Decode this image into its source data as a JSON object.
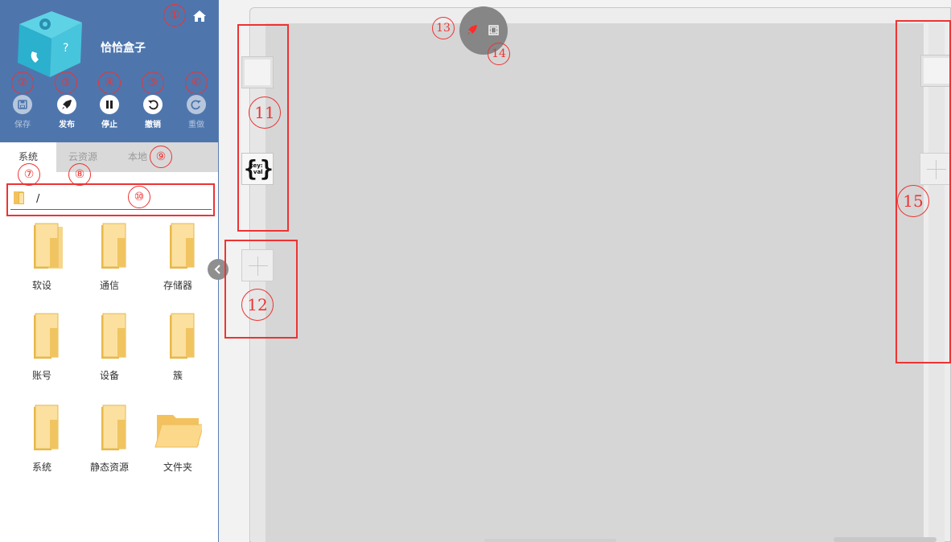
{
  "sidebar": {
    "app_title": "恰恰盒子",
    "toolbar": [
      {
        "id": "save",
        "label": "保存",
        "icon": "save-icon",
        "enabled": false
      },
      {
        "id": "publish",
        "label": "发布",
        "icon": "rocket-icon",
        "enabled": true
      },
      {
        "id": "stop",
        "label": "停止",
        "icon": "pause-icon",
        "enabled": true
      },
      {
        "id": "undo",
        "label": "撤销",
        "icon": "undo-icon",
        "enabled": true
      },
      {
        "id": "redo",
        "label": "重做",
        "icon": "redo-icon",
        "enabled": false
      }
    ],
    "tabs": [
      {
        "label": "系统",
        "active": true
      },
      {
        "label": "云资源",
        "active": false
      },
      {
        "label": "本地",
        "active": false
      }
    ],
    "path": "/",
    "files": [
      {
        "name": "软设",
        "type": "folder"
      },
      {
        "name": "通信",
        "type": "folder"
      },
      {
        "name": "存储器",
        "type": "folder"
      },
      {
        "name": "账号",
        "type": "folder"
      },
      {
        "name": "设备",
        "type": "folder"
      },
      {
        "name": "簇",
        "type": "folder"
      },
      {
        "name": "系统",
        "type": "folder"
      },
      {
        "name": "静态资源",
        "type": "folder"
      },
      {
        "name": "文件夹",
        "type": "folder-open"
      }
    ]
  },
  "workspace": {
    "kv_button_text": {
      "top": "key:",
      "bottom": "val"
    },
    "floating_icons": [
      "rocket-icon",
      "film-icon"
    ]
  },
  "annotations": [
    "①",
    "②",
    "③",
    "④",
    "⑤",
    "⑥",
    "⑦",
    "⑧",
    "⑨",
    "⑩",
    "11",
    "12",
    "13",
    "14",
    "15"
  ],
  "colors": {
    "header_bg": "#4e76ad",
    "annotation_red": "#e33",
    "canvas_gray": "#d6d6d6"
  }
}
